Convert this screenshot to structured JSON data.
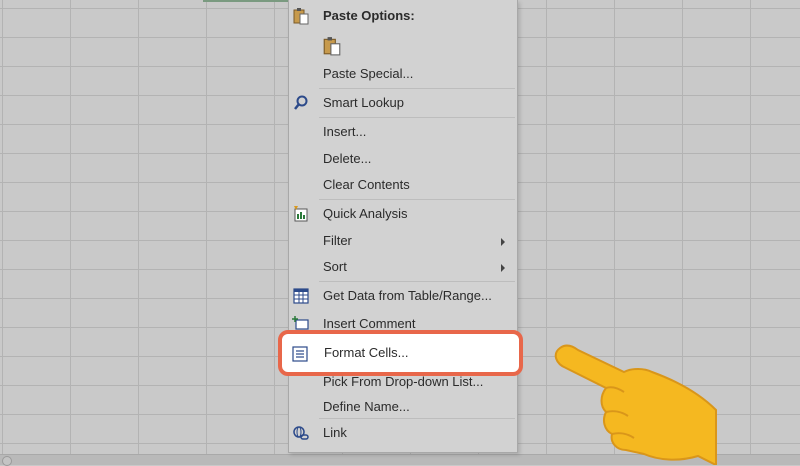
{
  "menu": {
    "paste_options": {
      "label": "Paste Options:",
      "icon": "clipboard-icon"
    },
    "paste_button": {
      "icon": "paste-clipboard-icon"
    },
    "items": [
      {
        "label": "Paste Special...",
        "icon": "",
        "submenu": false
      },
      {
        "label": "Smart Lookup",
        "icon": "magnifier-icon",
        "submenu": false
      },
      {
        "label": "Insert...",
        "icon": "",
        "submenu": false
      },
      {
        "label": "Delete...",
        "icon": "",
        "submenu": false
      },
      {
        "label": "Clear Contents",
        "icon": "",
        "submenu": false
      },
      {
        "label": "Quick Analysis",
        "icon": "quick-analysis-icon",
        "submenu": false
      },
      {
        "label": "Filter",
        "icon": "",
        "submenu": true
      },
      {
        "label": "Sort",
        "icon": "",
        "submenu": true
      },
      {
        "label": "Get Data from Table/Range...",
        "icon": "table-icon",
        "submenu": false
      },
      {
        "label": "Insert Comment",
        "icon": "comment-icon",
        "submenu": false
      },
      {
        "label": "Pick From Drop-down List...",
        "icon": "",
        "submenu": false
      },
      {
        "label": "Define Name...",
        "icon": "",
        "submenu": false
      },
      {
        "label": "Link",
        "icon": "link-icon",
        "submenu": false
      }
    ],
    "highlighted": {
      "label": "Format Cells...",
      "icon": "format-cells-icon"
    }
  },
  "colors": {
    "highlight_border": "#e8674a",
    "pointer_hand": "#f5b820",
    "menu_background": "#d2d2d2",
    "grid_background": "#c9c9c9"
  },
  "pointer": {
    "icon": "pointing-hand-icon"
  }
}
